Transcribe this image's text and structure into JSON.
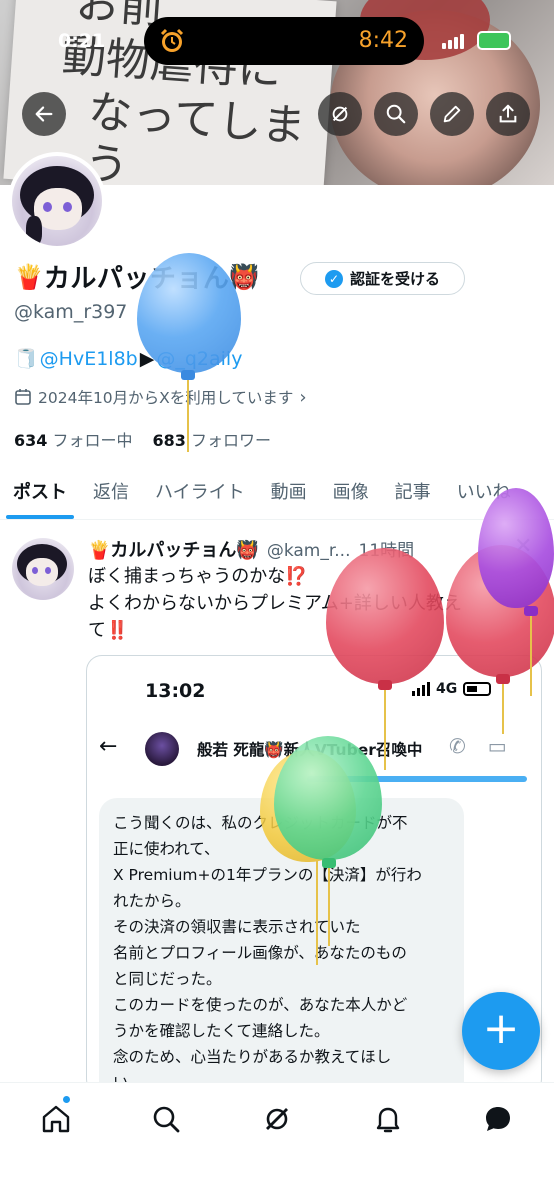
{
  "status_bar": {
    "time": "0:21",
    "island_time": "8:42"
  },
  "banner": {
    "scrawl_lines": [
      "お前",
      "動物虐待に",
      "なってしまう"
    ]
  },
  "profile": {
    "name": "カルパッチョん",
    "name_prefix_emoji": "🍟",
    "name_suffix_emoji": "👹",
    "verify_button": "認証を受ける",
    "handle": "@kam_r397",
    "bio": {
      "prefix_emoji": "🧻",
      "link1": "@HvE1l8b",
      "arrow": "▶",
      "link2": "@_q2aily"
    },
    "joined": "2024年10月からXを利用しています",
    "following_count": "634",
    "following_label": "フォロー中",
    "followers_count": "683",
    "followers_label": "フォロワー"
  },
  "tabs": [
    {
      "label": "ポスト",
      "active": true
    },
    {
      "label": "返信",
      "active": false
    },
    {
      "label": "ハイライト",
      "active": false
    },
    {
      "label": "動画",
      "active": false
    },
    {
      "label": "画像",
      "active": false
    },
    {
      "label": "記事",
      "active": false
    },
    {
      "label": "いいね",
      "active": false
    }
  ],
  "post": {
    "name": "🍟カルパッチョん👹",
    "handle": "@kam_r...",
    "time": "11時間",
    "line1": "ぼく捕まっちゃうのかな⁉️",
    "line2": "よくわからないからプレミアム+詳しい人教え",
    "line3": "て‼️",
    "media": {
      "time": "13:02",
      "network": "4G",
      "chat_name": "般若 死龍👹新人VTuber召喚中",
      "message_lines": [
        "こう聞くのは、私のクレジットカードが不",
        "正に使われて、",
        "X Premium+の1年プランの【決済】が行わ",
        "れたから。",
        "その決済の領収書に表示されていた",
        "名前とプロフィール画像が、あなたのもの",
        "と同じだった。",
        "このカードを使ったのが、あなた本人かど",
        "うかを確認したくて連絡した。",
        "念のため、心当たりがあるか教えてほし",
        "い。"
      ]
    }
  },
  "fab_label": "+",
  "colors": {
    "accent": "#1d9bf0",
    "text": "#0f1419",
    "muted": "#536471"
  }
}
